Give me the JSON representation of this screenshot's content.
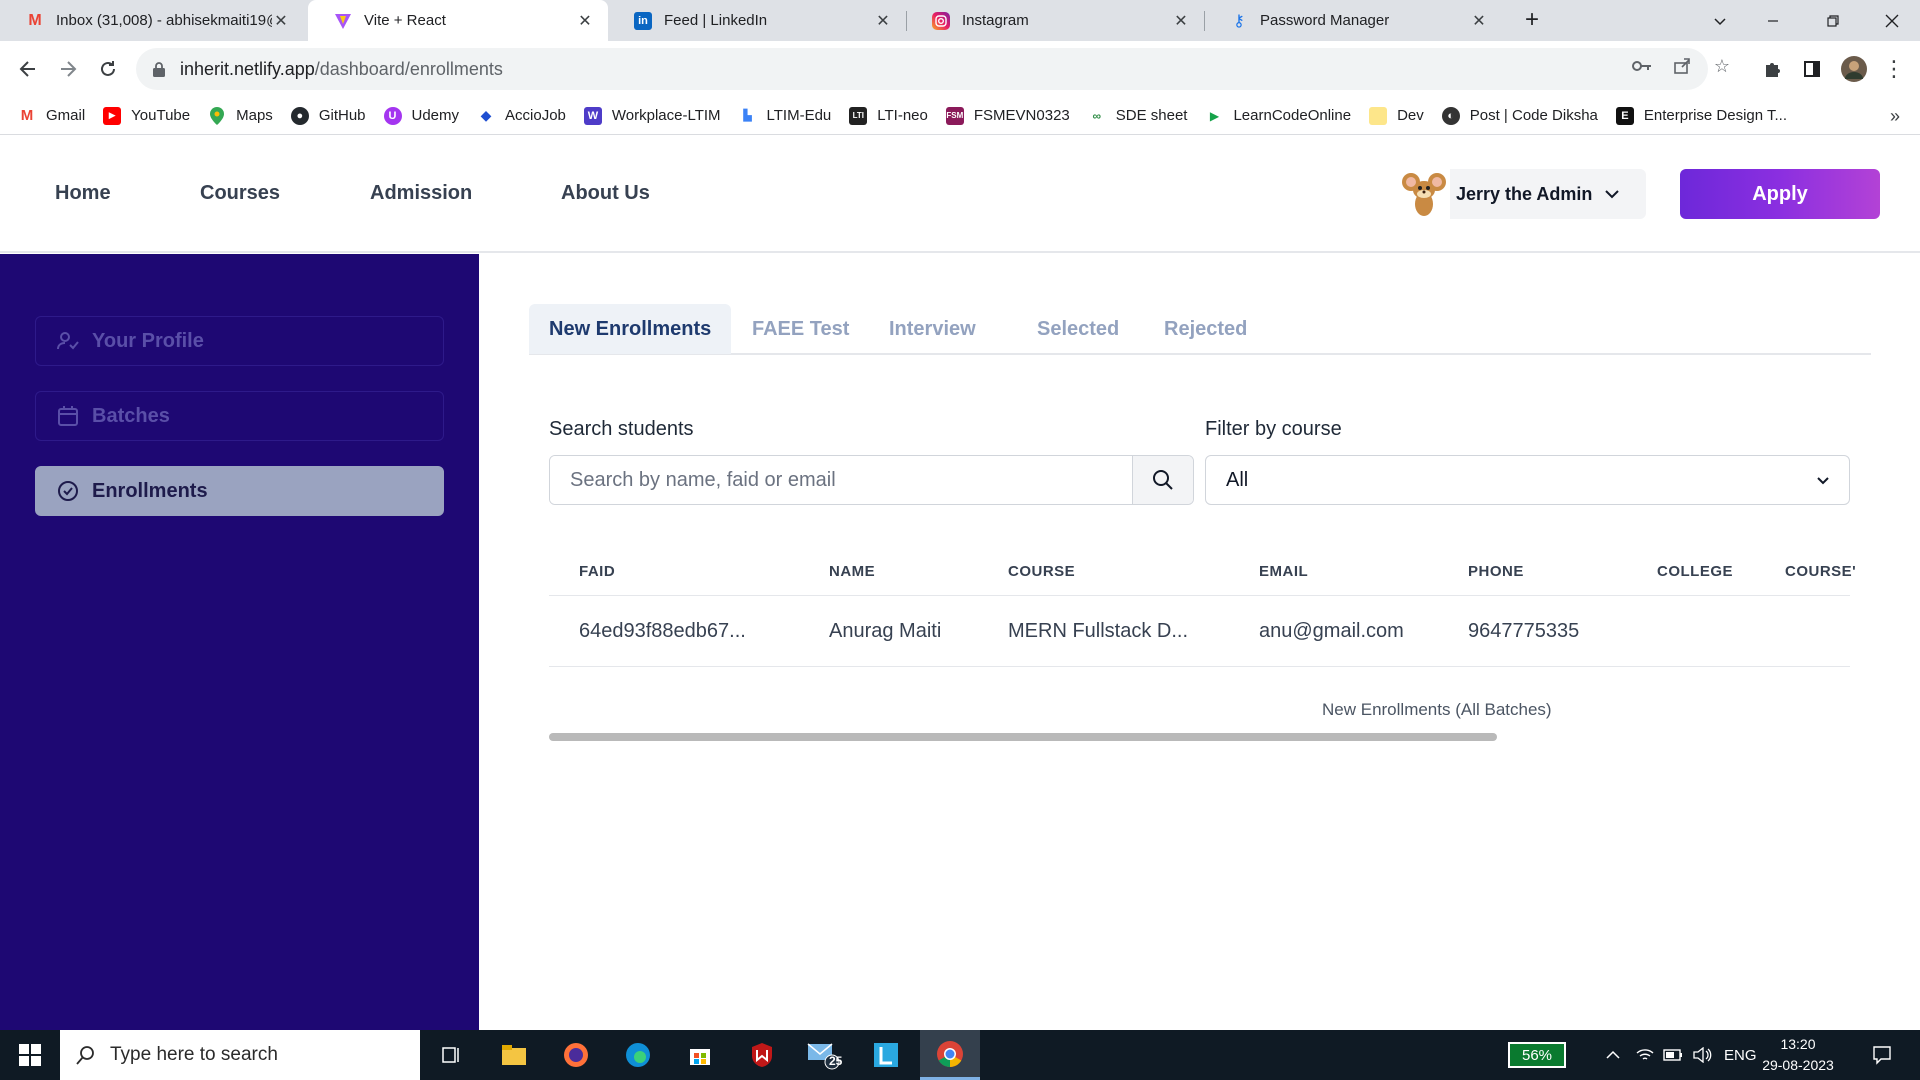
{
  "browser": {
    "tabs": [
      {
        "title": "Inbox (31,008) - abhisekmaiti19@",
        "icon": "gmail-icon",
        "active": false
      },
      {
        "title": "Vite + React",
        "icon": "vite-icon",
        "active": true
      },
      {
        "title": "Feed | LinkedIn",
        "icon": "linkedin-icon",
        "active": false
      },
      {
        "title": "Instagram",
        "icon": "instagram-icon",
        "active": false
      },
      {
        "title": "Password Manager",
        "icon": "key-icon",
        "active": false
      }
    ],
    "url_host": "inherit.netlify.app",
    "url_path": "/dashboard/enrollments",
    "bookmarks": [
      {
        "label": "Gmail",
        "icon": "gmail-icon"
      },
      {
        "label": "YouTube",
        "icon": "youtube-icon"
      },
      {
        "label": "Maps",
        "icon": "maps-icon"
      },
      {
        "label": "GitHub",
        "icon": "github-icon"
      },
      {
        "label": "Udemy",
        "icon": "udemy-icon"
      },
      {
        "label": "AccioJob",
        "icon": "acciojob-icon"
      },
      {
        "label": "Workplace-LTIM",
        "icon": "workplace-icon"
      },
      {
        "label": "LTIM-Edu",
        "icon": "ltim-edu-icon"
      },
      {
        "label": "LTI-neo",
        "icon": "lti-neo-icon"
      },
      {
        "label": "FSMEVN0323",
        "icon": "fsm-icon"
      },
      {
        "label": "SDE sheet",
        "icon": "sde-sheet-icon"
      },
      {
        "label": "LearnCodeOnline",
        "icon": "lco-icon"
      },
      {
        "label": "Dev",
        "icon": "folder-icon"
      },
      {
        "label": "Post | Code Diksha",
        "icon": "code-diksha-icon"
      },
      {
        "label": "Enterprise Design T...",
        "icon": "enterprise-icon"
      }
    ]
  },
  "header": {
    "nav": [
      "Home",
      "Courses",
      "Admission",
      "About Us"
    ],
    "user_name": "Jerry the Admin",
    "apply_label": "Apply"
  },
  "sidebar": {
    "items": [
      {
        "label": "Your Profile",
        "icon": "user-check-icon",
        "active": false
      },
      {
        "label": "Batches",
        "icon": "calendar-icon",
        "active": false
      },
      {
        "label": "Enrollments",
        "icon": "check-circle-icon",
        "active": true
      }
    ]
  },
  "main": {
    "tabs": [
      "New Enrollments",
      "FAEE Test",
      "Interview",
      "Selected",
      "Rejected"
    ],
    "active_tab": "New Enrollments",
    "search_label": "Search students",
    "search_placeholder": "Search by name, faid or email",
    "filter_label": "Filter by course",
    "filter_value": "All",
    "table": {
      "columns": [
        "FAID",
        "NAME",
        "COURSE",
        "EMAIL",
        "PHONE",
        "COLLEGE",
        "COURSE'"
      ],
      "rows": [
        [
          "64ed93f88edb67...",
          "Anurag Maiti",
          "MERN Fullstack D...",
          "anu@gmail.com",
          "9647775335",
          "",
          ""
        ]
      ],
      "caption": "New Enrollments (All Batches)"
    }
  },
  "taskbar": {
    "search_placeholder": "Type here to search",
    "battery": "56%",
    "language": "ENG",
    "time": "13:20",
    "date": "29-08-2023",
    "mail_badge": "25"
  },
  "colors": {
    "sidebar_bg": "#1e0873",
    "accent_purple": "#6d28d9",
    "active_tab_text": "#1e3a6e"
  }
}
